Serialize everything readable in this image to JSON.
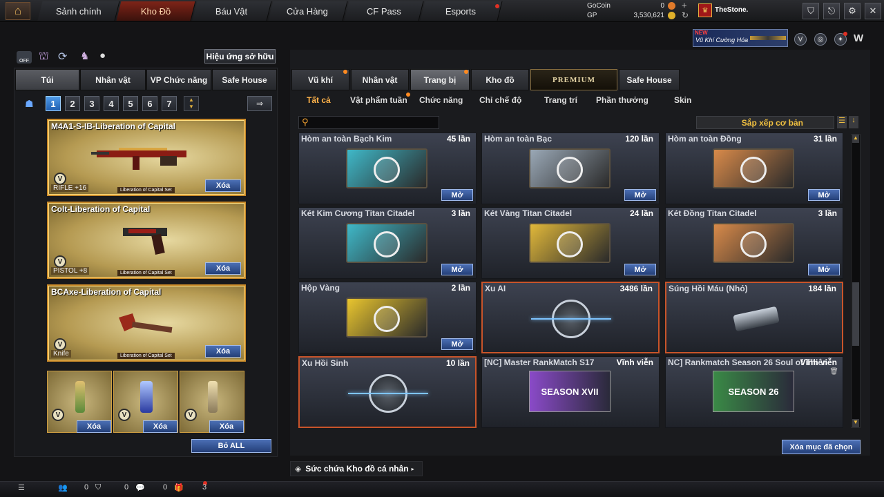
{
  "nav": {
    "tabs": [
      "Sảnh chính",
      "Kho Đồ",
      "Báu Vật",
      "Cửa Hàng",
      "CF Pass",
      "Esports"
    ],
    "active": "Kho Đồ"
  },
  "currency": {
    "gocoin_label": "GoCoin",
    "gocoin_value": "0",
    "gp_label": "GP",
    "gp_value": "3,530,621"
  },
  "user": {
    "name": "TheStone."
  },
  "banner": {
    "new": "NEW",
    "text": "Vũ Khí Cường Hóa"
  },
  "left": {
    "off_label": "OFF",
    "effect_button": "Hiệu ứng sở hữu",
    "tabs": [
      "Túi",
      "Nhân vật",
      "VP Chức năng",
      "Safe House"
    ],
    "pages": [
      "1",
      "2",
      "3",
      "4",
      "5",
      "6",
      "7"
    ],
    "cards": [
      {
        "name": "M4A1-S-IB-Liberation of Capital",
        "type": "RIFLE",
        "plus": "+16",
        "set": "Liberation of Capital Set",
        "delete": "Xóa",
        "v": "V"
      },
      {
        "name": "Colt-Liberation of Capital",
        "type": "PISTOL",
        "plus": "+8",
        "set": "Liberation of Capital Set",
        "delete": "Xóa",
        "v": "V"
      },
      {
        "name": "BCAxe-Liberation of Capital",
        "type": "Knife",
        "plus": "",
        "set": "Liberation of Capital Set",
        "delete": "Xóa",
        "v": "V"
      }
    ],
    "small_delete": "Xóa",
    "remove_all": "Bỏ ALL"
  },
  "right": {
    "tabs": [
      "Vũ khí",
      "Nhân vật",
      "Trang bị",
      "Kho đồ",
      "PREMIUM",
      "Safe House"
    ],
    "active_tab": "Trang bị",
    "filters": [
      "Tất cả",
      "Vật phẩm tuần",
      "Chức năng",
      "Chỉ chế độ",
      "Trang trí",
      "Phần thưởng",
      "Skin"
    ],
    "active_filter": "Tất cả",
    "sort_label": "Sắp xếp cơ bản",
    "items": [
      {
        "name": "Hòm an toàn Bạch Kim",
        "count": "45 lần",
        "btn": "Mở",
        "color": "#3fb8c8"
      },
      {
        "name": "Hòm an toàn Bạc",
        "count": "120 lần",
        "btn": "Mở",
        "color": "#9aa8b6"
      },
      {
        "name": "Hòm an toàn Đồng",
        "count": "31 lần",
        "btn": "Mở",
        "color": "#d88a4a"
      },
      {
        "name": "Két Kim Cương Titan Citadel",
        "count": "3 lần",
        "btn": "Mở",
        "color": "#3fb8c8"
      },
      {
        "name": "Két Vàng Titan Citadel",
        "count": "24 lần",
        "btn": "Mở",
        "color": "#e1b83a"
      },
      {
        "name": "Két Đồng Titan Citadel",
        "count": "3 lần",
        "btn": "Mở",
        "color": "#d88a4a"
      },
      {
        "name": "Hộp Vàng",
        "count": "2 lần",
        "btn": "Mở",
        "color": "#e9c52e"
      },
      {
        "name": "Xu AI",
        "count": "3486 lần",
        "btn": "",
        "color": "#7ec4ff"
      },
      {
        "name": "Súng Hồi Máu (Nhỏ)",
        "count": "184 lần",
        "btn": "",
        "color": "#8cc8ff"
      },
      {
        "name": "Xu Hồi Sinh",
        "count": "10 lần",
        "btn": "",
        "color": "#7ec4ff"
      },
      {
        "name": "[NC] Master RankMatch S17",
        "count": "Vĩnh viễn",
        "btn": "",
        "color": "#8a4ac8",
        "img_text": "SEASON XVII"
      },
      {
        "name": "NC] Rankmatch Season 26 Soul of Thiên",
        "count": "Vĩnh viễn",
        "btn": "",
        "color": "#3a8a46",
        "img_text": "SEASON 26"
      }
    ],
    "delete_selected": "Xóa mục đã chọn",
    "capacity": "Sức chứa Kho đồ cá nhân"
  },
  "status": {
    "c1": "0",
    "c2": "0",
    "c3": "0",
    "c4": "3"
  }
}
